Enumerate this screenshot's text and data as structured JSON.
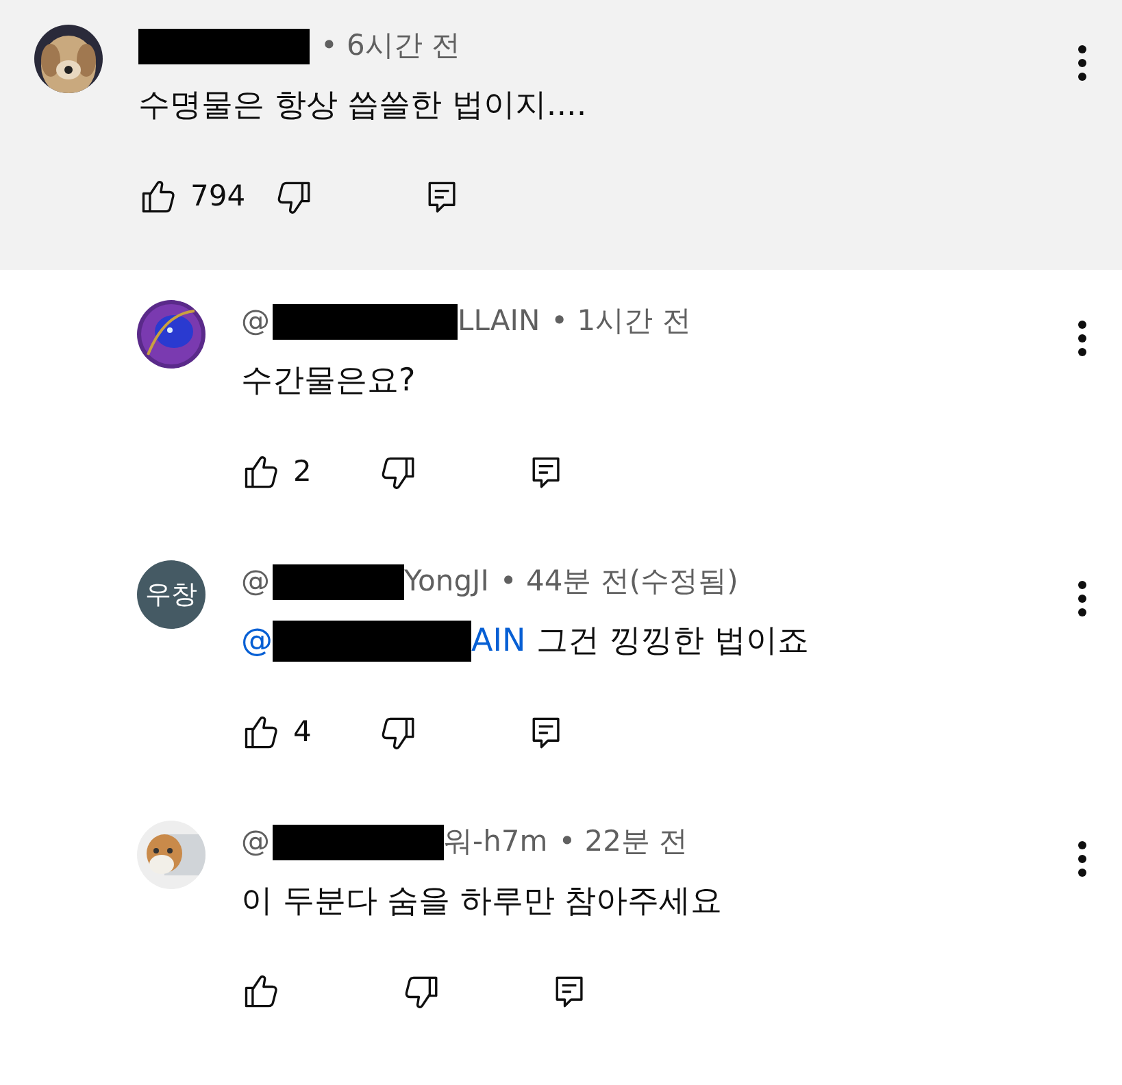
{
  "comments": [
    {
      "time": "• 6시간 전",
      "highlighted": true,
      "is_reply": false,
      "body": "수명물은 항상 씁쓸한 법이지....",
      "likes": "794"
    },
    {
      "author_prefix": "@",
      "author_suffix": "LLAIN",
      "time": "• 1시간 전",
      "highlighted": false,
      "is_reply": true,
      "body": "수간물은요?",
      "likes": "2"
    },
    {
      "avatar": {
        "kind": "initials",
        "initials": "우창",
        "color": "#455a64"
      },
      "author_prefix": "@",
      "author_suffix": "YongJI",
      "time": "• 44분 전(수정됨)",
      "highlighted": false,
      "is_reply": true,
      "mention_prefix": "@",
      "mention_suffix": "AIN",
      "body": "그건 낑낑한 법이죠",
      "likes": "4"
    },
    {
      "author_prefix": "@",
      "author_suffix": "워-h7m",
      "time": "• 22분 전",
      "highlighted": false,
      "is_reply": true,
      "body": "이 두분다 숨을 하루만 참아주세요"
    }
  ]
}
